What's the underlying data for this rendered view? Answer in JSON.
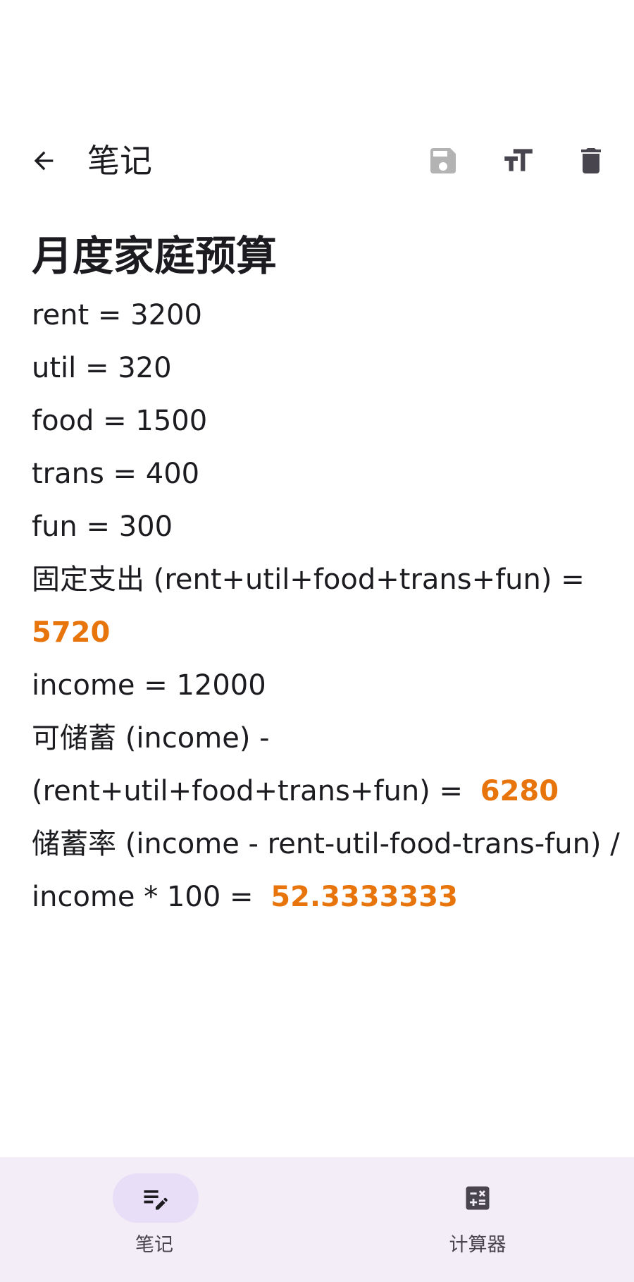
{
  "toolbar": {
    "title": "笔记",
    "icons": {
      "back": "arrow-back-icon",
      "save": "save-icon",
      "text_size": "text-size-icon",
      "delete": "delete-icon"
    }
  },
  "note": {
    "title": "月度家庭预算",
    "lines": {
      "l1": "rent = 3200",
      "l2": "util = 320",
      "l3": "food = 1500",
      "l4": "trans = 400",
      "l5": "fun = 300",
      "l6": "固定支出 (rent+util+food+trans+fun) =",
      "l7_result": "5720",
      "l8": "income = 12000",
      "l9": "可储蓄 (income) -",
      "l10": "(rent+util+food+trans+fun) = ",
      "l10_result": "6280",
      "l11": "储蓄率 (income - rent-util-food-trans-fun) /",
      "l12": "income * 100 = ",
      "l12_result": "52.3333333"
    }
  },
  "bottom_nav": {
    "items": [
      {
        "label": "笔记",
        "icon": "notes-edit-icon",
        "selected": true
      },
      {
        "label": "计算器",
        "icon": "calculator-icon",
        "selected": false
      }
    ]
  },
  "colors": {
    "result": "#e8740c",
    "nav_background": "#f3edf7",
    "nav_active_pill": "#e8def8",
    "icon_disabled": "#b3b3b3",
    "icon_default": "#49454f"
  }
}
